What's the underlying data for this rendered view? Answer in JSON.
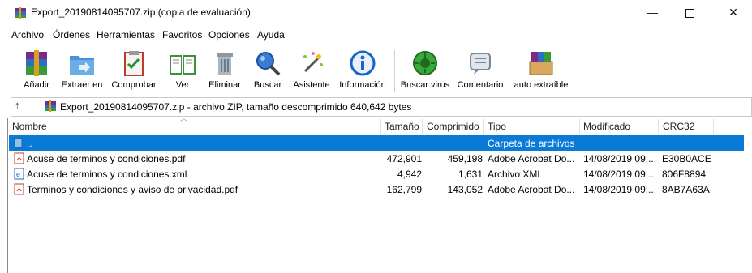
{
  "window": {
    "title": "Export_20190814095707.zip (copia de evaluación)",
    "min_glyph": "—",
    "close_glyph": "✕"
  },
  "menu": [
    "Archivo",
    "Órdenes",
    "Herramientas",
    "Favoritos",
    "Opciones",
    "Ayuda"
  ],
  "toolbar": [
    {
      "label": "Añadir",
      "icon": "add-archive-icon"
    },
    {
      "label": "Extraer en",
      "icon": "extract-folder-icon"
    },
    {
      "label": "Comprobar",
      "icon": "test-clipboard-icon"
    },
    {
      "label": "Ver",
      "icon": "view-book-icon"
    },
    {
      "label": "Eliminar",
      "icon": "trash-icon"
    },
    {
      "label": "Buscar",
      "icon": "search-icon"
    },
    {
      "label": "Asistente",
      "icon": "wizard-wand-icon"
    },
    {
      "label": "Información",
      "icon": "info-icon"
    },
    {
      "label": "Buscar virus",
      "icon": "virus-scan-icon"
    },
    {
      "label": "Comentario",
      "icon": "comment-icon"
    },
    {
      "label": "auto extraíble",
      "icon": "sfx-box-icon"
    }
  ],
  "address": {
    "up_glyph": "↑",
    "text": "Export_20190814095707.zip - archivo ZIP, tamaño descomprimido 640,642 bytes"
  },
  "columns": {
    "name": "Nombre",
    "size": "Tamaño",
    "packed": "Comprimido",
    "type": "Tipo",
    "modified": "Modificado",
    "crc": "CRC32"
  },
  "rows": [
    {
      "name": "..",
      "size": "",
      "packed": "",
      "type": "Carpeta de archivos",
      "modified": "",
      "crc": "",
      "icon": "parent-folder-icon",
      "selected": true
    },
    {
      "name": "Acuse de terminos y condiciones.pdf",
      "size": "472,901",
      "packed": "459,198",
      "type": "Adobe Acrobat Do...",
      "modified": "14/08/2019 09:...",
      "crc": "E30B0ACE",
      "icon": "pdf-file-icon"
    },
    {
      "name": "Acuse de terminos y condiciones.xml",
      "size": "4,942",
      "packed": "1,631",
      "type": "Archivo XML",
      "modified": "14/08/2019 09:...",
      "crc": "806F8894",
      "icon": "xml-file-icon"
    },
    {
      "name": "Terminos y condiciones y aviso de privacidad.pdf",
      "size": "162,799",
      "packed": "143,052",
      "type": "Adobe Acrobat Do...",
      "modified": "14/08/2019 09:...",
      "crc": "8AB7A63A",
      "icon": "pdf-file-icon"
    }
  ],
  "colors": {
    "selection": "#0a7ad7",
    "accent": "#1a64c8"
  }
}
